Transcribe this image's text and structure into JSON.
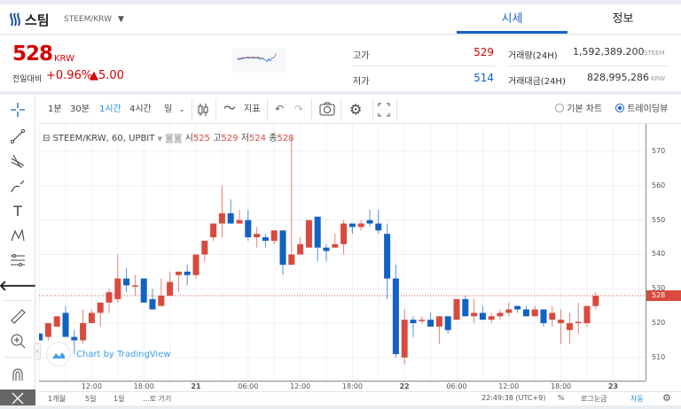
{
  "header": {
    "coin_name": "스팀",
    "pair": "STEEM/KRW",
    "tabs": [
      {
        "label": "시세",
        "active": true
      },
      {
        "label": "정보",
        "active": false
      }
    ]
  },
  "price": {
    "value": "528",
    "unit": "KRW",
    "change_label": "전일대비",
    "change_pct": "+0.96%",
    "change_abs": "▲5.00",
    "color": "#d60000"
  },
  "stats": {
    "high_label": "고가",
    "high": "529",
    "low_label": "저가",
    "low": "514",
    "volume_label": "거래량(24H)",
    "volume": "1,592,389.200",
    "volume_unit": "STEEM",
    "amount_label": "거래대금(24H)",
    "amount": "828,995,286",
    "amount_unit": "KRW"
  },
  "toolbar": {
    "intervals": [
      "1분",
      "30분",
      "1시간",
      "4시간",
      "일"
    ],
    "active_interval": "1시간",
    "indicators_label": "지표",
    "radio_basic": "기본 차트",
    "radio_tv": "트레이딩뷰",
    "radio_selected": "트레이딩뷰"
  },
  "legend": {
    "symbol": "STEEM/KRW, 60, UPBIT",
    "open_label": "시",
    "open": "525",
    "high_label": "고",
    "high": "529",
    "low_label": "저",
    "low": "524",
    "close_label": "종",
    "close": "528"
  },
  "watermark": "Chart by TradingView",
  "bottombar": {
    "ranges": [
      "1개월",
      "5일",
      "1일",
      "...로 가기"
    ],
    "clock": "22:49:38 (UTC+9)",
    "percent": "%",
    "log": "로그눈금",
    "auto": "자동"
  },
  "colors": {
    "up": "#d84a3e",
    "down": "#1261c4",
    "accent": "#1261c4"
  },
  "chart_data": {
    "type": "candlestick",
    "ylim": [
      507,
      577
    ],
    "y_ticks": [
      510,
      520,
      530,
      540,
      550,
      560,
      570
    ],
    "current_price": 528,
    "x_ticks": [
      {
        "label": "12:00",
        "at": "20 12:00"
      },
      {
        "label": "18:00",
        "at": "20 18:00"
      },
      {
        "label": "21",
        "at": "21 00:00",
        "bold": true
      },
      {
        "label": "06:00",
        "at": "21 06:00"
      },
      {
        "label": "12:00",
        "at": "21 12:00"
      },
      {
        "label": "18:00",
        "at": "21 18:00"
      },
      {
        "label": "22",
        "at": "22 00:00",
        "bold": true
      },
      {
        "label": "06:00",
        "at": "22 06:00"
      },
      {
        "label": "12:00",
        "at": "22 12:00"
      },
      {
        "label": "18:00",
        "at": "22 18:00"
      },
      {
        "label": "23",
        "at": "23 00:00",
        "bold": true
      }
    ],
    "grid": true,
    "candles": [
      [
        "20 06:00",
        517,
        517,
        515,
        515
      ],
      [
        "20 07:00",
        516,
        520,
        515,
        520
      ],
      [
        "20 08:00",
        519,
        522,
        519,
        522
      ],
      [
        "20 09:00",
        523,
        525,
        516,
        516
      ],
      [
        "20 10:00",
        516,
        518,
        511,
        515
      ],
      [
        "20 11:00",
        515,
        524,
        514,
        520
      ],
      [
        "20 12:00",
        520,
        524,
        520,
        523
      ],
      [
        "20 13:00",
        523,
        526,
        519,
        526
      ],
      [
        "20 14:00",
        526,
        530,
        523,
        529
      ],
      [
        "20 15:00",
        527,
        540,
        526,
        533
      ],
      [
        "20 16:00",
        533,
        536,
        529,
        531
      ],
      [
        "20 17:00",
        531,
        534,
        528,
        531
      ],
      [
        "20 18:00",
        533,
        533,
        526,
        526
      ],
      [
        "20 19:00",
        527,
        530,
        524,
        524
      ],
      [
        "20 20:00",
        525,
        533,
        525,
        528
      ],
      [
        "20 21:00",
        528,
        535,
        528,
        532
      ],
      [
        "20 22:00",
        534,
        535,
        529,
        535
      ],
      [
        "20 23:00",
        535,
        537,
        531,
        534
      ],
      [
        "21 00:00",
        534,
        540,
        533,
        540
      ],
      [
        "21 01:00",
        540,
        544,
        538,
        544
      ],
      [
        "21 02:00",
        545,
        549,
        544,
        549
      ],
      [
        "21 03:00",
        549,
        560,
        545,
        552
      ],
      [
        "21 04:00",
        552,
        556,
        549,
        549
      ],
      [
        "21 05:00",
        549,
        553,
        549,
        550
      ],
      [
        "21 06:00",
        550,
        553,
        544,
        545
      ],
      [
        "21 07:00",
        545,
        548,
        542,
        546
      ],
      [
        "21 08:00",
        545,
        546,
        542,
        544
      ],
      [
        "21 09:00",
        544,
        547,
        543,
        547
      ],
      [
        "21 10:00",
        547,
        547,
        534,
        537
      ],
      [
        "21 11:00",
        537,
        574,
        537,
        540
      ],
      [
        "21 12:00",
        540,
        545,
        540,
        543
      ],
      [
        "21 13:00",
        542,
        550,
        542,
        550
      ],
      [
        "21 14:00",
        551,
        551,
        538,
        542
      ],
      [
        "21 15:00",
        542,
        543,
        538,
        541
      ],
      [
        "21 16:00",
        542,
        546,
        542,
        543
      ],
      [
        "21 17:00",
        543,
        550,
        540,
        549
      ],
      [
        "21 18:00",
        549,
        549,
        546,
        548
      ],
      [
        "21 19:00",
        548,
        550,
        547,
        549
      ],
      [
        "21 20:00",
        550,
        553,
        548,
        549
      ],
      [
        "21 21:00",
        549,
        553,
        546,
        547
      ],
      [
        "21 22:00",
        546,
        549,
        527,
        533
      ],
      [
        "21 23:00",
        533,
        537,
        510,
        511
      ],
      [
        "22 00:00",
        510,
        524,
        508,
        521
      ],
      [
        "22 01:00",
        521,
        522,
        516,
        520
      ],
      [
        "22 02:00",
        520.6,
        522,
        520,
        521
      ],
      [
        "22 03:00",
        521,
        523,
        519,
        519
      ],
      [
        "22 04:00",
        519,
        522,
        514,
        522
      ],
      [
        "22 05:00",
        522,
        522,
        517,
        518
      ],
      [
        "22 06:00",
        521,
        527,
        521,
        527
      ],
      [
        "22 07:00",
        527,
        528,
        522,
        522
      ],
      [
        "22 08:00",
        522,
        527,
        520,
        523
      ],
      [
        "22 09:00",
        523,
        525,
        521,
        521
      ],
      [
        "22 10:00",
        521,
        523,
        520,
        522
      ],
      [
        "22 11:00",
        522,
        524,
        521,
        523
      ],
      [
        "22 12:00",
        523,
        526,
        522,
        524
      ],
      [
        "22 13:00",
        525,
        525,
        523,
        524
      ],
      [
        "22 14:00",
        524,
        525,
        522,
        522
      ],
      [
        "22 15:00",
        522,
        525,
        522,
        524
      ],
      [
        "22 16:00",
        524,
        524,
        519,
        520
      ],
      [
        "22 17:00",
        521,
        525,
        519,
        523
      ],
      [
        "22 18:00",
        520,
        524,
        514,
        521
      ],
      [
        "22 19:00",
        518,
        523,
        514,
        520
      ],
      [
        "22 20:00",
        520,
        526,
        517,
        520.4
      ],
      [
        "22 21:00",
        520,
        525,
        519,
        525
      ],
      [
        "22 22:00",
        525,
        529,
        524,
        528
      ]
    ]
  }
}
